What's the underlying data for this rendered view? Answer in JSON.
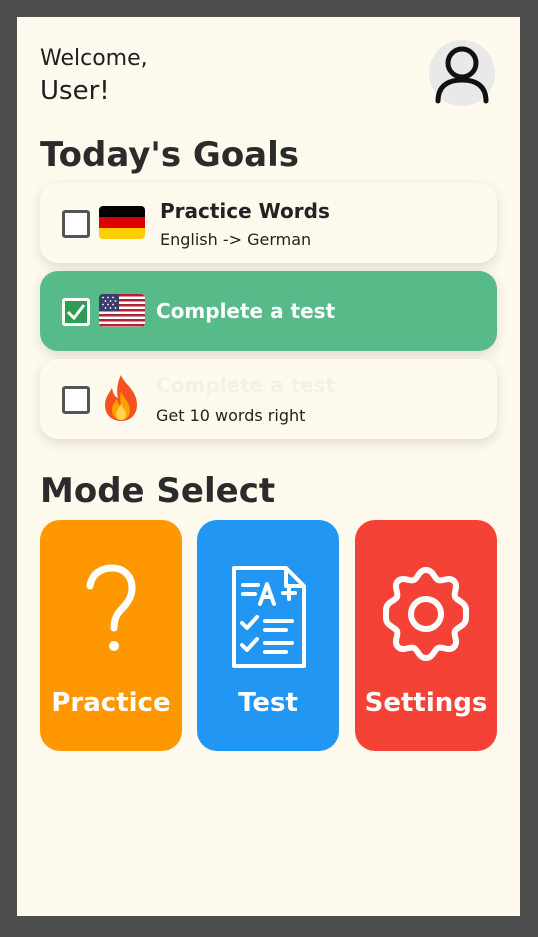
{
  "header": {
    "welcome_line1": "Welcome,",
    "welcome_line2": "User!",
    "avatar_icon": "user-icon"
  },
  "goals": {
    "title": "Today's Goals",
    "items": [
      {
        "title": "Practice Words",
        "subtitle": "English -> German",
        "checked": false,
        "icon": "german-flag-icon"
      },
      {
        "title": "Complete a test",
        "subtitle": "",
        "checked": true,
        "icon": "us-flag-icon"
      },
      {
        "title": "Complete a test",
        "subtitle": "Get 10 words right",
        "checked": false,
        "icon": "flame-icon"
      }
    ]
  },
  "modes": {
    "title": "Mode Select",
    "items": [
      {
        "label": "Practice",
        "icon": "question-mark-icon",
        "color": "#ff9800"
      },
      {
        "label": "Test",
        "icon": "test-document-icon",
        "color": "#2196f3"
      },
      {
        "label": "Settings",
        "icon": "gear-icon",
        "color": "#f44336"
      }
    ]
  },
  "colors": {
    "background": "#fffaee",
    "completed_goal": "#57bb89"
  }
}
